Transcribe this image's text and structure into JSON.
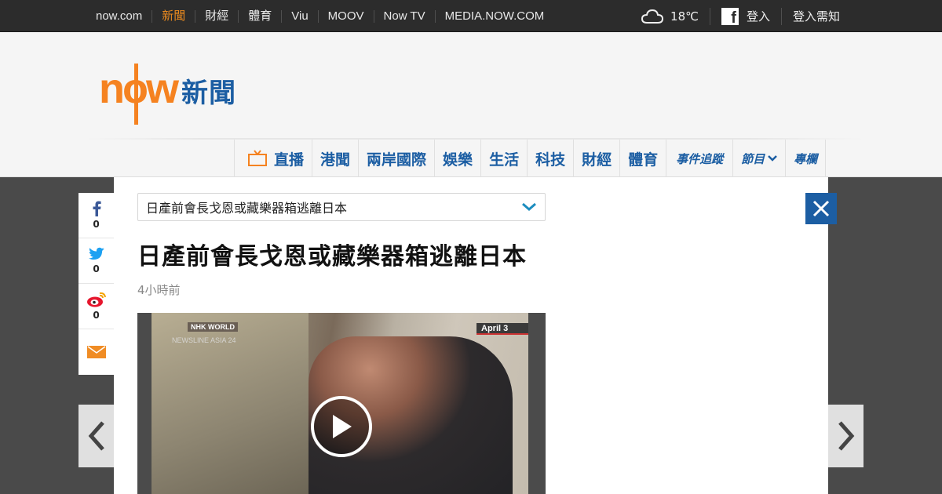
{
  "topbar": {
    "links": [
      "now.com",
      "新聞",
      "財經",
      "體育",
      "Viu",
      "MOOV",
      "Now TV",
      "MEDIA.NOW.COM"
    ],
    "active_index": 1,
    "temperature": "18℃",
    "weather_icon": "cloud-icon",
    "fb_login": "登入",
    "login_note": "登入需知"
  },
  "logo": {
    "brand": "now",
    "section": "新聞"
  },
  "mainnav": {
    "items": [
      "直播",
      "港聞",
      "兩岸國際",
      "娛樂",
      "生活",
      "科技",
      "財經",
      "體育",
      "事件追蹤",
      "節目",
      "專欄"
    ]
  },
  "share": {
    "facebook_count": "0",
    "twitter_count": "0",
    "weibo_count": "0"
  },
  "article": {
    "select_value": "日產前會長戈恩或藏樂器箱逃離日本",
    "title": "日產前會長戈恩或藏樂器箱逃離日本",
    "time": "4小時前"
  },
  "video": {
    "channel": "NHK WORLD",
    "program": "NEWSLINE ASIA 24",
    "date_tag": "April 3"
  },
  "colors": {
    "accent": "#e8891f",
    "brand_blue": "#1c5ea3",
    "topbar": "#2c2c2c"
  }
}
